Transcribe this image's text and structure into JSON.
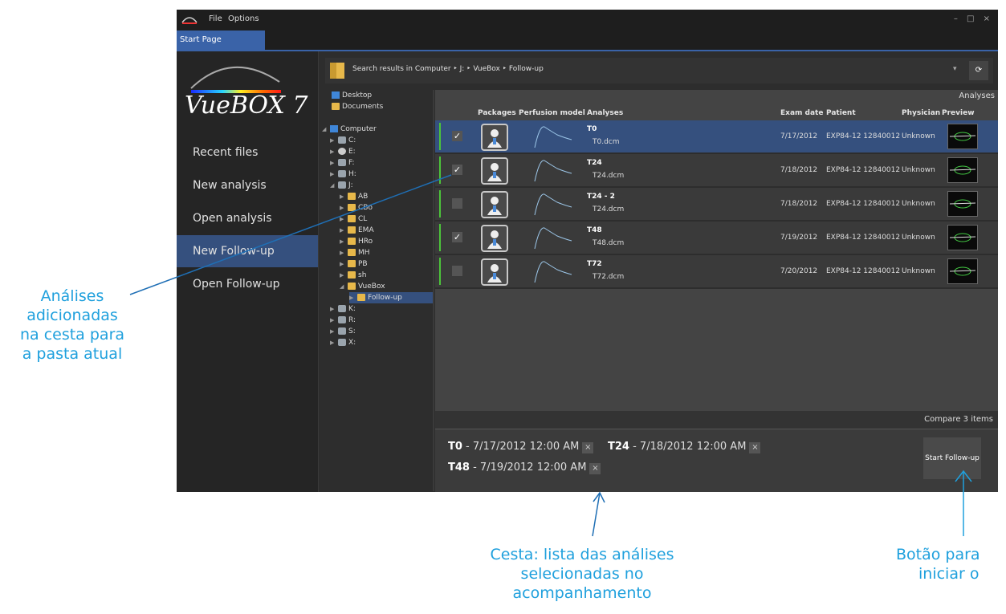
{
  "menu": {
    "file": "File",
    "options": "Options"
  },
  "window_controls": "– □ ×",
  "tab": {
    "label": "Start Page"
  },
  "brand": {
    "name": "VueBOX",
    "version": "7"
  },
  "nav": [
    {
      "label": "Recent files"
    },
    {
      "label": "New analysis"
    },
    {
      "label": "Open analysis"
    },
    {
      "label": "New Follow-up",
      "active": true
    },
    {
      "label": "Open Follow-up"
    }
  ],
  "path": {
    "text": "Search results in Computer ‣ J: ‣ VueBox ‣ Follow-up",
    "dropdown": "▾",
    "refresh": "⟳"
  },
  "tree": {
    "desktop": "Desktop",
    "documents": "Documents",
    "computer": "Computer",
    "drives": {
      "c": "C:",
      "e": "E:",
      "f": "F:",
      "h": "H:",
      "j": "J:",
      "k": "K:",
      "r": "R:",
      "s": "S:",
      "x": "X:"
    },
    "folders": {
      "ab": "AB",
      "cbo": "CBo",
      "cl": "CL",
      "ema": "EMA",
      "hro": "HRo",
      "mh": "MH",
      "pb": "PB",
      "sh": "sh",
      "vuebox": "VueBox",
      "followup": "Follow-up"
    }
  },
  "grid": {
    "title": "Analyses",
    "headers": {
      "packages": "Packages",
      "perfusion": "Perfusion model",
      "analyses": "Analyses",
      "exam_date": "Exam date",
      "patient": "Patient",
      "physician": "Physician",
      "preview": "Preview"
    },
    "rows": [
      {
        "name": "T0",
        "file": "T0.dcm",
        "date": "7/17/2012",
        "patient": "EXP84-12 12840012",
        "physician": "Unknown",
        "checked": true
      },
      {
        "name": "T24",
        "file": "T24.dcm",
        "date": "7/18/2012",
        "patient": "EXP84-12 12840012",
        "physician": "Unknown",
        "checked": true
      },
      {
        "name": "T24 - 2",
        "file": "T24.dcm",
        "date": "7/18/2012",
        "patient": "EXP84-12 12840012",
        "physician": "Unknown",
        "checked": false
      },
      {
        "name": "T48",
        "file": "T48.dcm",
        "date": "7/19/2012",
        "patient": "EXP84-12 12840012",
        "physician": "Unknown",
        "checked": true
      },
      {
        "name": "T72",
        "file": "T72.dcm",
        "date": "7/20/2012",
        "patient": "EXP84-12 12840012",
        "physician": "Unknown",
        "checked": false
      }
    ]
  },
  "compare": {
    "label": "Compare 3 items"
  },
  "basket": {
    "items": [
      {
        "name": "T0",
        "date": " - 7/17/2012 12:00 AM",
        "remove": "×"
      },
      {
        "name": "T24",
        "date": " - 7/18/2012 12:00 AM",
        "remove": "×"
      },
      {
        "name": "T48",
        "date": " - 7/19/2012 12:00 AM",
        "remove": "×"
      }
    ],
    "start_button": "Start Follow-up"
  },
  "annotations": {
    "left": [
      "Análises",
      "adicionadas",
      "na cesta para",
      "a pasta atual"
    ],
    "bottom": [
      "Cesta: lista das análises",
      "selecionadas no",
      "acompanhamento"
    ],
    "right": [
      "Botão para",
      "iniciar o"
    ]
  },
  "colors": {
    "accent": "#3a63a8",
    "selected": "#35507e",
    "green": "#4cc43a",
    "annotation": "#1fa0dd"
  }
}
